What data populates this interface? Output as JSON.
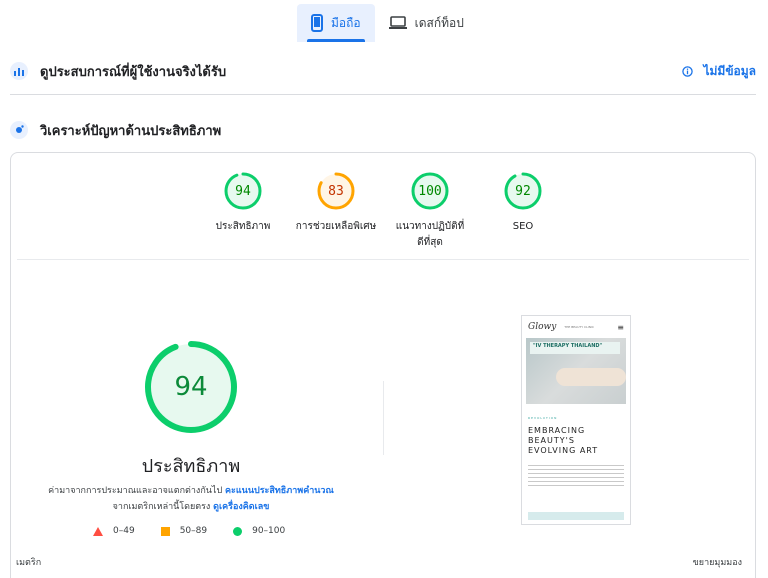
{
  "tabs": [
    {
      "label": "มือถือ",
      "active": true,
      "icon": "mobile-icon"
    },
    {
      "label": "เดสก์ท็อป",
      "active": false,
      "icon": "desktop-icon"
    }
  ],
  "field_data": {
    "title": "ดูประสบการณ์ที่ผู้ใช้งานจริงได้รับ",
    "status": "ไม่มีข้อมูล",
    "icon": "field-data-icon"
  },
  "diagnose": {
    "title": "วิเคราะห์ปัญหาด้านประสิทธิภาพ",
    "icon": "lab-data-icon"
  },
  "scores": [
    {
      "value": "94",
      "label": "ประสิทธิภาพ",
      "level": "pass"
    },
    {
      "value": "83",
      "label": "การช่วยเหลือพิเศษ",
      "level": "average"
    },
    {
      "value": "100",
      "label": "แนวทางปฏิบัติที่ดีที่สุด",
      "level": "pass"
    },
    {
      "value": "92",
      "label": "SEO",
      "level": "pass"
    }
  ],
  "main_score": {
    "value": "94",
    "title": "ประสิทธิภาพ"
  },
  "description": {
    "text1": "ค่ามาจากการประมาณและอาจแตกต่างกันไป ",
    "link1": "คะแนนประสิทธิภาพคำนวณ",
    "text2": "จากเมตริกเหล่านี้โดยตรง ",
    "link2": "ดูเครื่องคิดเลข"
  },
  "legend": [
    {
      "range": "0–49",
      "icon": "fail-triangle-icon"
    },
    {
      "range": "50–89",
      "icon": "average-square-icon"
    },
    {
      "range": "90–100",
      "icon": "pass-circle-icon"
    }
  ],
  "screenshot": {
    "logo": "Glowy",
    "subtitle": "THE BEAUTY CLINIC",
    "banner": "\"IV THERAPY THAILAND\"",
    "tag": "REVOLUTION",
    "heading_lines": [
      "EMBRACING",
      "BEAUTY'S",
      "EVOLVING ART"
    ]
  },
  "footer": {
    "metrics_label": "เมตริก",
    "expand_label": "ขยายมุมมอง"
  },
  "colors": {
    "pass": "#0cce6b",
    "pass_text": "#008800",
    "average": "#ffa400",
    "average_text": "#c33300",
    "fail": "#ff4e42",
    "accent": "#1a73e8"
  }
}
